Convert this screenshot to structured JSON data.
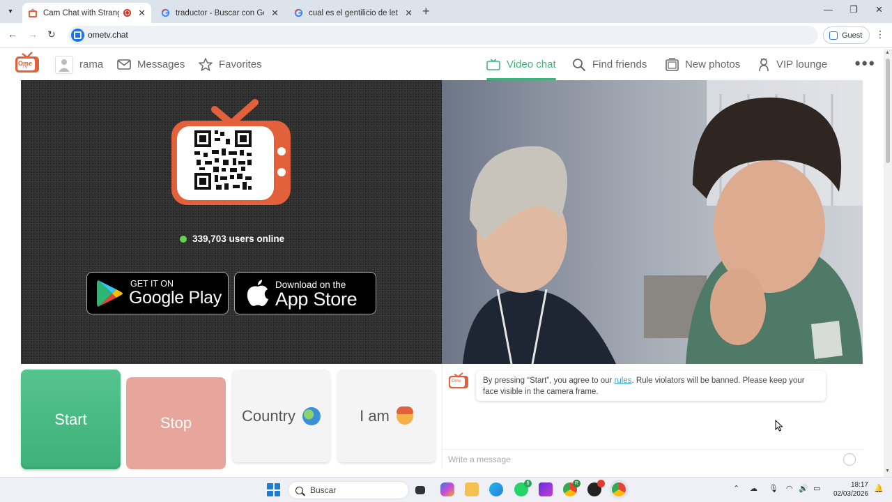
{
  "browser": {
    "tabs": [
      {
        "title": "Cam Chat with Strangers or",
        "active": true
      },
      {
        "title": "traductor - Buscar con Google",
        "active": false
      },
      {
        "title": "cual es el gentilicio de letonia -",
        "active": false
      }
    ],
    "url": "ometv.chat",
    "profile_label": "Guest"
  },
  "header": {
    "logo_text_top": "Ome",
    "logo_text_bottom": "TV",
    "user_name": "rama",
    "nav": {
      "messages": "Messages",
      "favorites": "Favorites",
      "video_chat": "Video chat",
      "find_friends": "Find friends",
      "new_photos": "New photos",
      "vip_lounge": "VIP lounge"
    },
    "more_icon": "ellipsis-icon",
    "accent_color": "#3cb37a"
  },
  "left_panel": {
    "users_online": "339,703 users online",
    "google_play": {
      "small": "GET IT ON",
      "large": "Google Play"
    },
    "app_store": {
      "small": "Download on the",
      "large": "App Store"
    }
  },
  "controls": {
    "start": "Start",
    "stop": "Stop",
    "country": "Country",
    "i_am": "I am",
    "start_color": "#4dbd86",
    "stop_color": "#e7a59b"
  },
  "chat": {
    "notice_before": "By pressing “Start”, you agree to our ",
    "notice_link": "rules",
    "notice_after": ". Rule violators will be banned. Please keep your face visible in the camera frame.",
    "input_placeholder": "Write a message"
  },
  "taskbar": {
    "search_label": "Buscar",
    "time": "18:17",
    "date": "02/03/2026",
    "whatsapp_badge": "6",
    "chrome_badge": "R"
  }
}
